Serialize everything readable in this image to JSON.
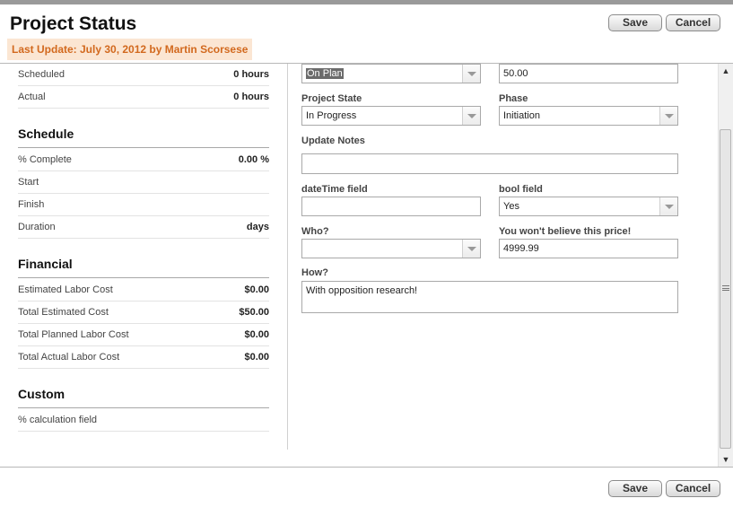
{
  "header": {
    "title": "Project Status",
    "last_update": "Last Update: July 30, 2012 by Martin Scorsese",
    "save_label": "Save",
    "cancel_label": "Cancel"
  },
  "footer": {
    "save_label": "Save",
    "cancel_label": "Cancel"
  },
  "left": {
    "top_rows": [
      {
        "label": "Scheduled",
        "value": "0  hours"
      },
      {
        "label": "Actual",
        "value": "0  hours"
      }
    ],
    "schedule": {
      "title": "Schedule",
      "rows": [
        {
          "label": "% Complete",
          "value": "0.00 %"
        },
        {
          "label": "Start",
          "value": ""
        },
        {
          "label": "Finish",
          "value": ""
        },
        {
          "label": "Duration",
          "value": "days"
        }
      ]
    },
    "financial": {
      "title": "Financial",
      "rows": [
        {
          "label": "Estimated Labor Cost",
          "value": "$0.00"
        },
        {
          "label": "Total Estimated Cost",
          "value": "$50.00"
        },
        {
          "label": "Total Planned Labor Cost",
          "value": "$0.00"
        },
        {
          "label": "Total Actual Labor Cost",
          "value": "$0.00"
        }
      ]
    },
    "custom": {
      "title": "Custom",
      "rows": [
        {
          "label": "% calculation field",
          "value": ""
        }
      ]
    }
  },
  "right": {
    "status_select": {
      "value": "On Plan"
    },
    "top_number": {
      "value": "50.00"
    },
    "project_state": {
      "label": "Project State",
      "value": "In Progress"
    },
    "phase": {
      "label": "Phase",
      "value": "Initiation"
    },
    "update_notes": {
      "label": "Update Notes",
      "value": ""
    },
    "datetime_field": {
      "label": "dateTime field",
      "value": ""
    },
    "bool_field": {
      "label": "bool field",
      "value": "Yes"
    },
    "who": {
      "label": "Who?",
      "value": ""
    },
    "price": {
      "label": "You won't believe this price!",
      "value": "4999.99"
    },
    "how": {
      "label": "How?",
      "value": "With opposition research!"
    }
  },
  "colors": {
    "last_update_bg": "#fbe6d3",
    "last_update_text": "#d2691e",
    "selection_highlight": "#6b6b6b"
  },
  "icons": {
    "select_arrow": "chevron-down-icon",
    "scroll_up": "arrow-up-icon",
    "scroll_down": "arrow-down-icon"
  }
}
